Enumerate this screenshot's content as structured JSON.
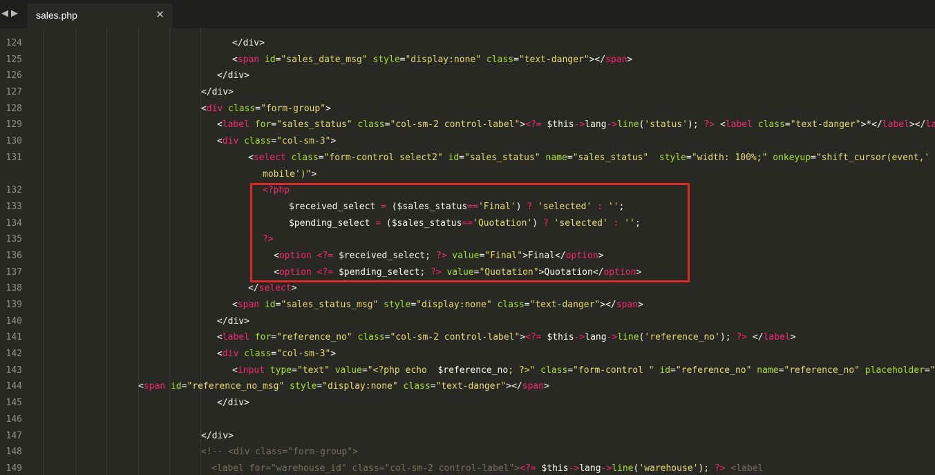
{
  "tabbar": {
    "back_icon": "◀",
    "forward_icon": "▶",
    "tab_title": "sales.php",
    "close_icon": "✕"
  },
  "editor": {
    "partial_top_line": "          .--  --  -  .--      .  .-",
    "line_numbers": [
      "124",
      "125",
      "126",
      "127",
      "128",
      "129",
      "130",
      "131",
      "",
      "132",
      "133",
      "134",
      "135",
      "136",
      "137",
      "138",
      "139",
      "140",
      "141",
      "142",
      "143",
      "144",
      "145",
      "146",
      "147",
      "148",
      "149"
    ],
    "lines": [
      {
        "indent": 272,
        "parts": [
          [
            "p",
            "</div>"
          ]
        ]
      },
      {
        "indent": 272,
        "parts": [
          [
            "p",
            "<"
          ],
          [
            "t",
            "span"
          ],
          [
            "a",
            " id"
          ],
          [
            "p",
            "="
          ],
          [
            "s",
            "\"sales_date_msg\""
          ],
          [
            "a",
            " style"
          ],
          [
            "p",
            "="
          ],
          [
            "s",
            "\"display:none\""
          ],
          [
            "a",
            " class"
          ],
          [
            "p",
            "="
          ],
          [
            "s",
            "\"text-danger\""
          ],
          [
            "p",
            "></"
          ],
          [
            "t",
            "span"
          ],
          [
            "p",
            ">"
          ]
        ]
      },
      {
        "indent": 250,
        "parts": [
          [
            "p",
            "</div>"
          ]
        ]
      },
      {
        "indent": 227,
        "parts": [
          [
            "p",
            "</div>"
          ]
        ]
      },
      {
        "indent": 227,
        "parts": [
          [
            "p",
            "<"
          ],
          [
            "t",
            "div"
          ],
          [
            "a",
            " class"
          ],
          [
            "p",
            "="
          ],
          [
            "s",
            "\"form-group\""
          ],
          [
            "p",
            ">"
          ]
        ]
      },
      {
        "indent": 250,
        "parts": [
          [
            "p",
            "<"
          ],
          [
            "t",
            "label"
          ],
          [
            "a",
            " for"
          ],
          [
            "p",
            "="
          ],
          [
            "s",
            "\"sales_status\""
          ],
          [
            "a",
            " class"
          ],
          [
            "p",
            "="
          ],
          [
            "s",
            "\"col-sm-2 control-label\""
          ],
          [
            "p",
            ">"
          ],
          [
            "k",
            "<?="
          ],
          [
            "p",
            " "
          ],
          [
            "v",
            "$this"
          ],
          [
            "k",
            "->"
          ],
          [
            "p",
            "lang"
          ],
          [
            "k",
            "->"
          ],
          [
            "a",
            "line"
          ],
          [
            "p",
            "("
          ],
          [
            "s",
            "'status'"
          ],
          [
            "p",
            "); "
          ],
          [
            "k",
            "?>"
          ],
          [
            "p",
            " <"
          ],
          [
            "t",
            "label"
          ],
          [
            "a",
            " class"
          ],
          [
            "p",
            "="
          ],
          [
            "s",
            "\"text-danger\""
          ],
          [
            "p",
            ">*</"
          ],
          [
            "t",
            "label"
          ],
          [
            "p",
            "></"
          ],
          [
            "t",
            "label"
          ],
          [
            "p",
            ">"
          ]
        ]
      },
      {
        "indent": 250,
        "parts": [
          [
            "p",
            "<"
          ],
          [
            "t",
            "div"
          ],
          [
            "a",
            " class"
          ],
          [
            "p",
            "="
          ],
          [
            "s",
            "\"col-sm-3\""
          ],
          [
            "p",
            ">"
          ]
        ]
      },
      {
        "indent": 295,
        "parts": [
          [
            "p",
            "<"
          ],
          [
            "t",
            "select"
          ],
          [
            "a",
            " class"
          ],
          [
            "p",
            "="
          ],
          [
            "s",
            "\"form-control select2\""
          ],
          [
            "a",
            " id"
          ],
          [
            "p",
            "="
          ],
          [
            "s",
            "\"sales_status\""
          ],
          [
            "a",
            " name"
          ],
          [
            "p",
            "="
          ],
          [
            "s",
            "\"sales_status\""
          ],
          [
            "p",
            "  "
          ],
          [
            "a",
            "style"
          ],
          [
            "p",
            "="
          ],
          [
            "s",
            "\"width: 100%;\""
          ],
          [
            "a",
            " onkeyup"
          ],
          [
            "p",
            "="
          ],
          [
            "s",
            "\"shift_cursor(event,'"
          ]
        ]
      },
      {
        "indent": 316,
        "parts": [
          [
            "s",
            "mobile')\""
          ],
          [
            "p",
            ">"
          ]
        ]
      },
      {
        "indent": 316,
        "parts": [
          [
            "k",
            "<?php"
          ]
        ]
      },
      {
        "indent": 354,
        "parts": [
          [
            "v",
            "$received_select"
          ],
          [
            "p",
            " "
          ],
          [
            "k",
            "="
          ],
          [
            "p",
            " ("
          ],
          [
            "v",
            "$sales_status"
          ],
          [
            "k",
            "=="
          ],
          [
            "s",
            "'Final'"
          ],
          [
            "p",
            ") "
          ],
          [
            "k",
            "?"
          ],
          [
            "p",
            " "
          ],
          [
            "s",
            "'selected'"
          ],
          [
            "p",
            " "
          ],
          [
            "k",
            ":"
          ],
          [
            "p",
            " "
          ],
          [
            "s",
            "''"
          ],
          [
            "p",
            ";"
          ]
        ]
      },
      {
        "indent": 354,
        "parts": [
          [
            "v",
            "$pending_select"
          ],
          [
            "p",
            " "
          ],
          [
            "k",
            "="
          ],
          [
            "p",
            " ("
          ],
          [
            "v",
            "$sales_status"
          ],
          [
            "k",
            "=="
          ],
          [
            "s",
            "'Quotation'"
          ],
          [
            "p",
            ") "
          ],
          [
            "k",
            "?"
          ],
          [
            "p",
            " "
          ],
          [
            "s",
            "'selected'"
          ],
          [
            "p",
            " "
          ],
          [
            "k",
            ":"
          ],
          [
            "p",
            " "
          ],
          [
            "s",
            "''"
          ],
          [
            "p",
            ";"
          ]
        ]
      },
      {
        "indent": 316,
        "parts": [
          [
            "k",
            "?>"
          ]
        ]
      },
      {
        "indent": 332,
        "parts": [
          [
            "p",
            "<"
          ],
          [
            "t",
            "option"
          ],
          [
            "p",
            " "
          ],
          [
            "k",
            "<?="
          ],
          [
            "p",
            " "
          ],
          [
            "v",
            "$received_select"
          ],
          [
            "p",
            "; "
          ],
          [
            "k",
            "?>"
          ],
          [
            "a",
            " value"
          ],
          [
            "p",
            "="
          ],
          [
            "s",
            "\"Final\""
          ],
          [
            "p",
            ">Final</"
          ],
          [
            "t",
            "option"
          ],
          [
            "p",
            ">"
          ]
        ]
      },
      {
        "indent": 332,
        "parts": [
          [
            "p",
            "<"
          ],
          [
            "t",
            "option"
          ],
          [
            "p",
            " "
          ],
          [
            "k",
            "<?="
          ],
          [
            "p",
            " "
          ],
          [
            "v",
            "$pending_select"
          ],
          [
            "p",
            "; "
          ],
          [
            "k",
            "?>"
          ],
          [
            "a",
            " value"
          ],
          [
            "p",
            "="
          ],
          [
            "s",
            "\"Quotation\""
          ],
          [
            "p",
            ">Quotation</"
          ],
          [
            "t",
            "option"
          ],
          [
            "p",
            ">"
          ]
        ]
      },
      {
        "indent": 295,
        "parts": [
          [
            "p",
            "</"
          ],
          [
            "t",
            "select"
          ],
          [
            "p",
            ">"
          ]
        ]
      },
      {
        "indent": 272,
        "parts": [
          [
            "p",
            "<"
          ],
          [
            "t",
            "span"
          ],
          [
            "a",
            " id"
          ],
          [
            "p",
            "="
          ],
          [
            "s",
            "\"sales_status_msg\""
          ],
          [
            "a",
            " style"
          ],
          [
            "p",
            "="
          ],
          [
            "s",
            "\"display:none\""
          ],
          [
            "a",
            " class"
          ],
          [
            "p",
            "="
          ],
          [
            "s",
            "\"text-danger\""
          ],
          [
            "p",
            "></"
          ],
          [
            "t",
            "span"
          ],
          [
            "p",
            ">"
          ]
        ]
      },
      {
        "indent": 250,
        "parts": [
          [
            "p",
            "</div>"
          ]
        ]
      },
      {
        "indent": 250,
        "parts": [
          [
            "p",
            "<"
          ],
          [
            "t",
            "label"
          ],
          [
            "a",
            " for"
          ],
          [
            "p",
            "="
          ],
          [
            "s",
            "\"reference_no\""
          ],
          [
            "a",
            " class"
          ],
          [
            "p",
            "="
          ],
          [
            "s",
            "\"col-sm-2 control-label\""
          ],
          [
            "p",
            ">"
          ],
          [
            "k",
            "<?="
          ],
          [
            "p",
            " "
          ],
          [
            "v",
            "$this"
          ],
          [
            "k",
            "->"
          ],
          [
            "p",
            "lang"
          ],
          [
            "k",
            "->"
          ],
          [
            "a",
            "line"
          ],
          [
            "p",
            "("
          ],
          [
            "s",
            "'reference_no'"
          ],
          [
            "p",
            "); "
          ],
          [
            "k",
            "?>"
          ],
          [
            "p",
            " </"
          ],
          [
            "t",
            "label"
          ],
          [
            "p",
            ">"
          ]
        ]
      },
      {
        "indent": 250,
        "parts": [
          [
            "p",
            "<"
          ],
          [
            "t",
            "div"
          ],
          [
            "a",
            " class"
          ],
          [
            "p",
            "="
          ],
          [
            "s",
            "\"col-sm-3\""
          ],
          [
            "p",
            ">"
          ]
        ]
      },
      {
        "indent": 272,
        "parts": [
          [
            "p",
            "<"
          ],
          [
            "t",
            "input"
          ],
          [
            "a",
            " type"
          ],
          [
            "p",
            "="
          ],
          [
            "s",
            "\"text\""
          ],
          [
            "a",
            " value"
          ],
          [
            "p",
            "="
          ],
          [
            "s",
            "\"<?php echo  "
          ],
          [
            "v",
            "$reference_no"
          ],
          [
            "s",
            "; ?>\""
          ],
          [
            "a",
            " class"
          ],
          [
            "p",
            "="
          ],
          [
            "s",
            "\"form-control \""
          ],
          [
            "a",
            " id"
          ],
          [
            "p",
            "="
          ],
          [
            "s",
            "\"reference_no\""
          ],
          [
            "a",
            " name"
          ],
          [
            "p",
            "="
          ],
          [
            "s",
            "\"reference_no\""
          ],
          [
            "a",
            " placeholder"
          ],
          [
            "p",
            "="
          ],
          [
            "s",
            "\"\""
          ],
          [
            "p",
            " >"
          ]
        ]
      },
      {
        "indent": 136,
        "parts": [
          [
            "p",
            "<"
          ],
          [
            "t",
            "span"
          ],
          [
            "a",
            " id"
          ],
          [
            "p",
            "="
          ],
          [
            "s",
            "\"reference_no_msg\""
          ],
          [
            "a",
            " style"
          ],
          [
            "p",
            "="
          ],
          [
            "s",
            "\"display:none\""
          ],
          [
            "a",
            " class"
          ],
          [
            "p",
            "="
          ],
          [
            "s",
            "\"text-danger\""
          ],
          [
            "p",
            "></"
          ],
          [
            "t",
            "span"
          ],
          [
            "p",
            ">"
          ]
        ]
      },
      {
        "indent": 250,
        "parts": [
          [
            "p",
            "</div>"
          ]
        ]
      },
      {
        "indent": 0,
        "parts": []
      },
      {
        "indent": 227,
        "parts": [
          [
            "p",
            "</div>"
          ]
        ]
      },
      {
        "indent": 227,
        "parts": [
          [
            "c",
            "<!-- <div class=\"form-group\">"
          ]
        ]
      },
      {
        "indent": 242,
        "parts": [
          [
            "c",
            "<label for=\"warehouse_id\" class=\"col-sm-2 control-label\">"
          ],
          [
            "k",
            "<?="
          ],
          [
            "p",
            " "
          ],
          [
            "v",
            "$this"
          ],
          [
            "k",
            "->"
          ],
          [
            "p",
            "lang"
          ],
          [
            "k",
            "->"
          ],
          [
            "a",
            "line"
          ],
          [
            "p",
            "("
          ],
          [
            "s",
            "'warehouse'"
          ],
          [
            "p",
            "); "
          ],
          [
            "k",
            "?>"
          ],
          [
            "c",
            " <label"
          ]
        ]
      }
    ]
  }
}
